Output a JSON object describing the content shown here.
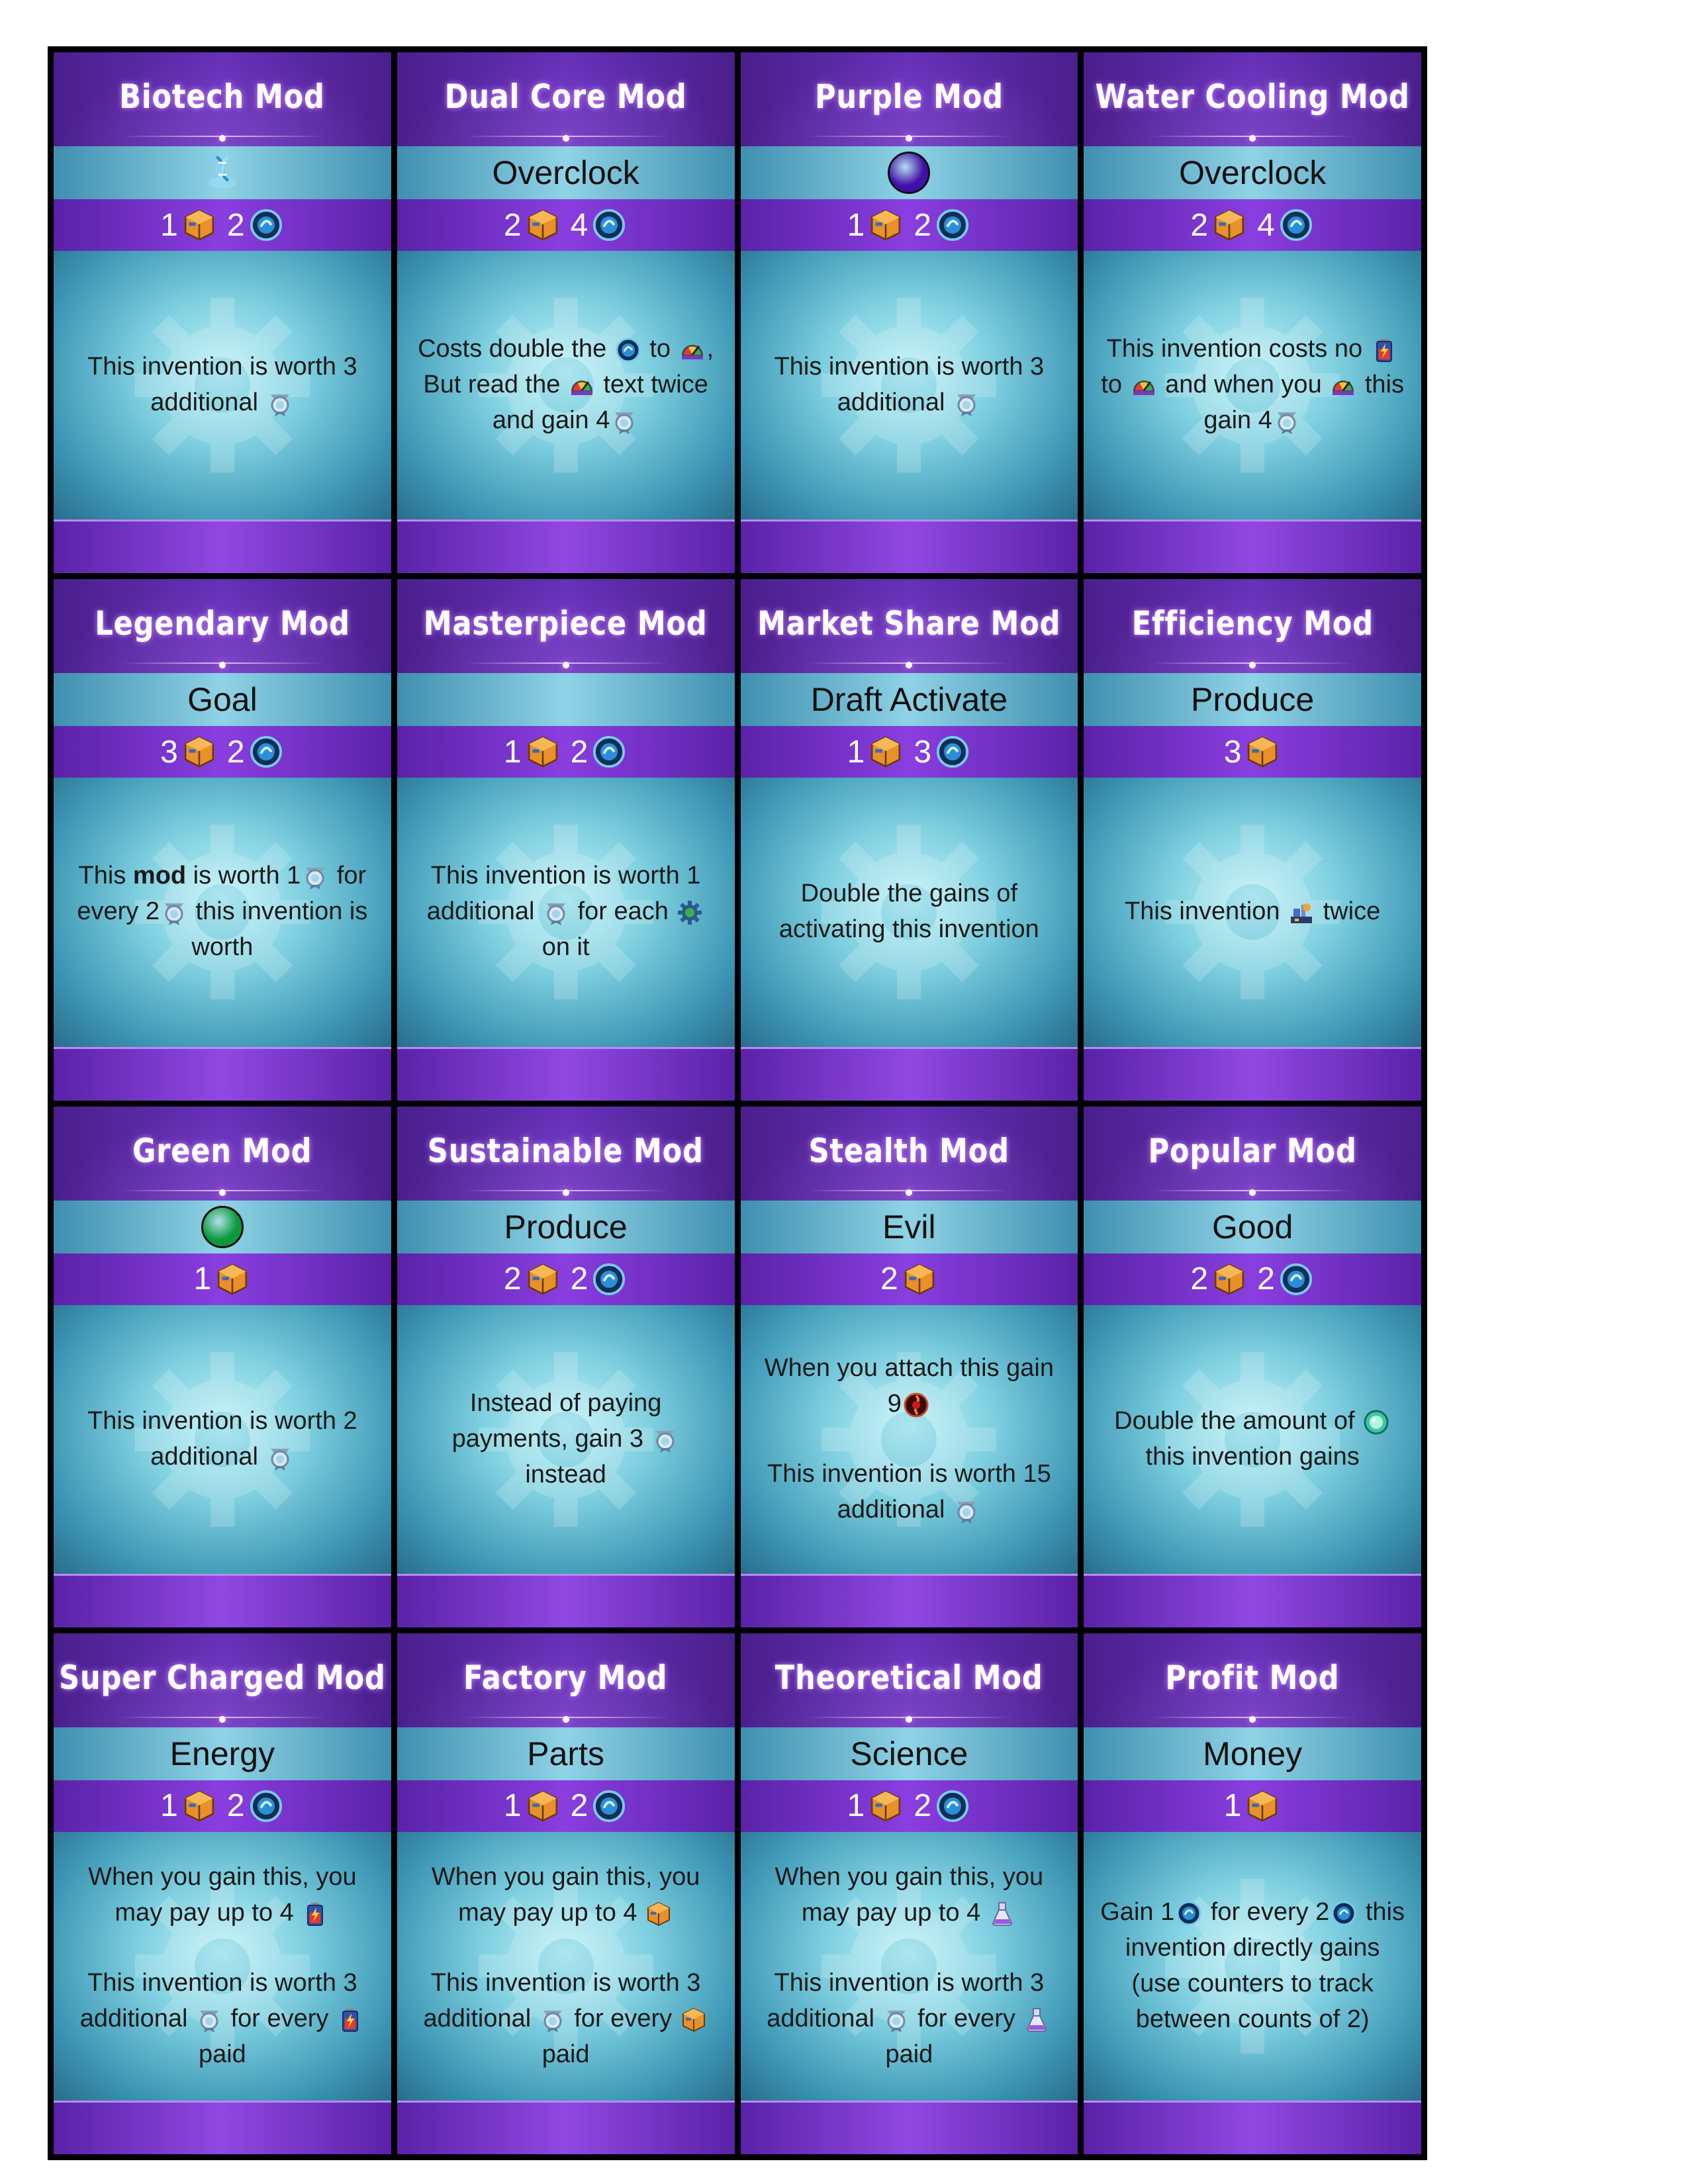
{
  "colors": {
    "purple_trait": "#4010a8",
    "green_trait": "#0a9a3c"
  },
  "cards": [
    {
      "title": "Biotech Mod",
      "type": {
        "kind": "icon",
        "icon": "biotech-icon"
      },
      "cost": [
        {
          "n": "1",
          "icon": "parts-icon"
        },
        {
          "n": "2",
          "icon": "energy-icon"
        }
      ],
      "text": [
        [
          "This invention is worth 3 additional ",
          {
            "i": "award-icon"
          }
        ]
      ]
    },
    {
      "title": "Dual Core Mod",
      "type": {
        "kind": "text",
        "label": "Overclock"
      },
      "cost": [
        {
          "n": "2",
          "icon": "parts-icon"
        },
        {
          "n": "4",
          "icon": "energy-icon"
        }
      ],
      "text": [
        [
          "Costs double the ",
          {
            "i": "energy-icon"
          },
          " to ",
          {
            "i": "overclock-icon"
          },
          ", But read the ",
          {
            "i": "overclock-icon"
          },
          " text twice and gain 4",
          {
            "i": "award-icon"
          }
        ]
      ]
    },
    {
      "title": "Purple Mod",
      "type": {
        "kind": "swatch",
        "color": "purple_trait"
      },
      "cost": [
        {
          "n": "1",
          "icon": "parts-icon"
        },
        {
          "n": "2",
          "icon": "energy-icon"
        }
      ],
      "text": [
        [
          "This invention is worth 3 additional ",
          {
            "i": "award-icon"
          }
        ]
      ]
    },
    {
      "title": "Water Cooling Mod",
      "type": {
        "kind": "text",
        "label": "Overclock"
      },
      "cost": [
        {
          "n": "2",
          "icon": "parts-icon"
        },
        {
          "n": "4",
          "icon": "energy-icon"
        }
      ],
      "text": [
        [
          "This invention costs no ",
          {
            "i": "battery-icon"
          },
          " to ",
          {
            "i": "overclock-icon"
          },
          " and when you ",
          {
            "i": "overclock-icon"
          },
          " this gain 4",
          {
            "i": "award-icon"
          }
        ]
      ]
    },
    {
      "title": "Legendary Mod",
      "type": {
        "kind": "text",
        "label": "Goal"
      },
      "cost": [
        {
          "n": "3",
          "icon": "parts-icon"
        },
        {
          "n": "2",
          "icon": "energy-icon"
        }
      ],
      "text": [
        [
          "This ",
          {
            "b": "mod"
          },
          " is worth 1",
          {
            "i": "award-icon"
          },
          " for every 2",
          {
            "i": "award-icon"
          },
          " this invention is worth"
        ]
      ]
    },
    {
      "title": "Masterpiece Mod",
      "type": {
        "kind": "blank"
      },
      "cost": [
        {
          "n": "1",
          "icon": "parts-icon"
        },
        {
          "n": "2",
          "icon": "energy-icon"
        }
      ],
      "text": [
        [
          "This invention is worth 1 additional ",
          {
            "i": "award-icon"
          },
          " for each ",
          {
            "i": "mod-gear-icon"
          },
          " on it"
        ]
      ]
    },
    {
      "title": "Market Share Mod",
      "type": {
        "kind": "text",
        "label": "Draft Activate"
      },
      "cost": [
        {
          "n": "1",
          "icon": "parts-icon"
        },
        {
          "n": "3",
          "icon": "energy-icon"
        }
      ],
      "text": [
        [
          "Double the gains of activating this invention"
        ]
      ]
    },
    {
      "title": "Efficiency Mod",
      "type": {
        "kind": "text",
        "label": "Produce"
      },
      "cost": [
        {
          "n": "3",
          "icon": "parts-icon"
        }
      ],
      "text": [
        [
          "This invention ",
          {
            "i": "produce-icon"
          },
          " twice"
        ]
      ]
    },
    {
      "title": "Green Mod",
      "type": {
        "kind": "swatch",
        "color": "green_trait"
      },
      "cost": [
        {
          "n": "1",
          "icon": "parts-icon"
        }
      ],
      "text": [
        [
          "This invention is worth 2 additional ",
          {
            "i": "award-icon"
          }
        ]
      ]
    },
    {
      "title": "Sustainable Mod",
      "type": {
        "kind": "text",
        "label": "Produce"
      },
      "cost": [
        {
          "n": "2",
          "icon": "parts-icon"
        },
        {
          "n": "2",
          "icon": "energy-icon"
        }
      ],
      "text": [
        [
          "Instead of paying payments, gain 3 ",
          {
            "i": "award-icon"
          },
          " instead"
        ]
      ]
    },
    {
      "title": "Stealth Mod",
      "type": {
        "kind": "text",
        "label": "Evil"
      },
      "cost": [
        {
          "n": "2",
          "icon": "parts-icon"
        }
      ],
      "text": [
        [
          "When you attach this gain 9",
          {
            "i": "evil-icon"
          }
        ],
        [
          "This invention is worth 15 additional ",
          {
            "i": "award-icon"
          }
        ]
      ]
    },
    {
      "title": "Popular Mod",
      "type": {
        "kind": "text",
        "label": "Good"
      },
      "cost": [
        {
          "n": "2",
          "icon": "parts-icon"
        },
        {
          "n": "2",
          "icon": "energy-icon"
        }
      ],
      "text": [
        [
          "Double the amount of ",
          {
            "i": "good-icon"
          },
          " this invention gains"
        ]
      ]
    },
    {
      "title": "Super Charged Mod",
      "type": {
        "kind": "text",
        "label": "Energy"
      },
      "cost": [
        {
          "n": "1",
          "icon": "parts-icon"
        },
        {
          "n": "2",
          "icon": "energy-icon"
        }
      ],
      "text": [
        [
          "When you gain this, you may pay up to 4 ",
          {
            "i": "battery-icon"
          }
        ],
        [
          "This invention is worth 3 additional ",
          {
            "i": "award-icon"
          },
          " for every ",
          {
            "i": "battery-icon"
          },
          " paid"
        ]
      ]
    },
    {
      "title": "Factory Mod",
      "type": {
        "kind": "text",
        "label": "Parts"
      },
      "cost": [
        {
          "n": "1",
          "icon": "parts-icon"
        },
        {
          "n": "2",
          "icon": "energy-icon"
        }
      ],
      "text": [
        [
          "When you gain this, you may pay up to 4 ",
          {
            "i": "parts-icon"
          }
        ],
        [
          "This invention is worth 3 additional ",
          {
            "i": "award-icon"
          },
          " for every ",
          {
            "i": "parts-icon"
          },
          " paid"
        ]
      ]
    },
    {
      "title": "Theoretical Mod",
      "type": {
        "kind": "text",
        "label": "Science"
      },
      "cost": [
        {
          "n": "1",
          "icon": "parts-icon"
        },
        {
          "n": "2",
          "icon": "energy-icon"
        }
      ],
      "text": [
        [
          "When you gain this, you may pay up to 4 ",
          {
            "i": "flask-icon"
          }
        ],
        [
          "This invention is worth 3 additional ",
          {
            "i": "award-icon"
          },
          " for every ",
          {
            "i": "flask-icon"
          },
          " paid"
        ]
      ]
    },
    {
      "title": "Profit Mod",
      "type": {
        "kind": "text",
        "label": "Money"
      },
      "cost": [
        {
          "n": "1",
          "icon": "parts-icon"
        }
      ],
      "text": [
        [
          "Gain 1",
          {
            "i": "energy-icon"
          },
          " for every 2",
          {
            "i": "energy-icon"
          },
          " this invention directly gains (use counters to track between counts of 2)"
        ]
      ]
    }
  ]
}
